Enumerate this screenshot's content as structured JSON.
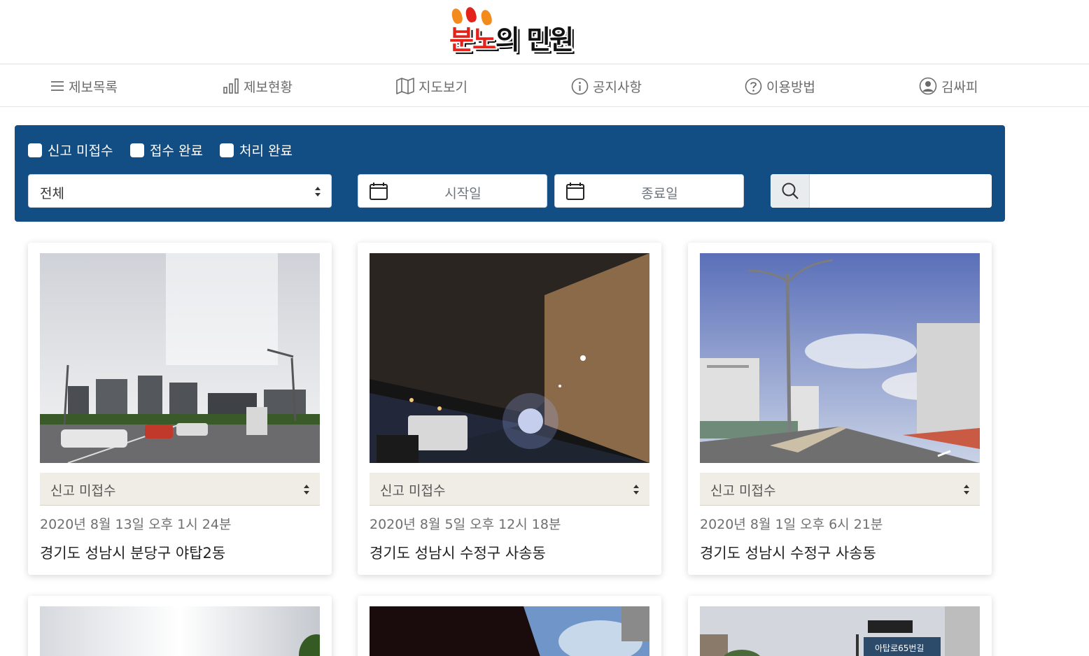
{
  "header": {
    "logo_text_red": "분노",
    "logo_text_black": "의 민원"
  },
  "nav": [
    {
      "label": "제보목록",
      "icon": "menu-icon"
    },
    {
      "label": "제보현황",
      "icon": "bar-chart-icon"
    },
    {
      "label": "지도보기",
      "icon": "map-icon"
    },
    {
      "label": "공지사항",
      "icon": "info-icon"
    },
    {
      "label": "이용방법",
      "icon": "question-icon"
    },
    {
      "label": "김싸피",
      "icon": "user-icon"
    }
  ],
  "filter": {
    "checkboxes": [
      "신고 미접수",
      "접수 완료",
      "처리 완료"
    ],
    "select_value": "전체",
    "start_placeholder": "시작일",
    "end_placeholder": "종료일",
    "search_placeholder": "",
    "panel_color": "#124d84"
  },
  "cards": [
    {
      "status": "신고 미접수",
      "date": "2020년 8월 13일  오후 1시 24분",
      "address": "경기도 성남시 분당구 야탑2동"
    },
    {
      "status": "신고 미접수",
      "date": "2020년 8월 5일  오후 12시 18분",
      "address": "경기도 성남시 수정구 사송동"
    },
    {
      "status": "신고 미접수",
      "date": "2020년 8월 1일  오후 6시 21분",
      "address": "경기도 성남시 수정구 사송동"
    }
  ],
  "sign_text": "아탑로65번길"
}
